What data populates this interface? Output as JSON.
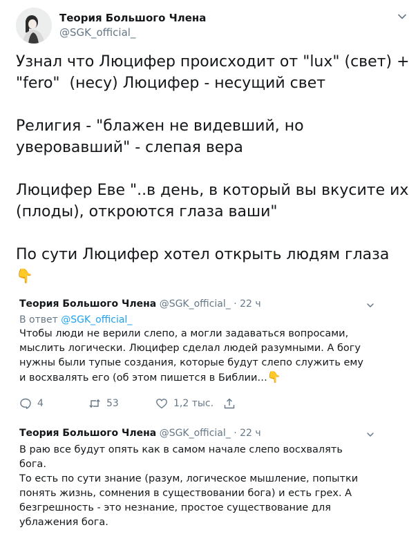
{
  "main_tweet": {
    "author_name": "Теория Большого Члена",
    "author_handle": "@SGK_official_",
    "paragraphs": [
      "Узнал что Люцифер происходит от \"lux\" (свет) + \"fero\"  (несу) Люцифер - несущий свет",
      "Религия - \"блажен не видевший, но уверовавший\" - слепая вера",
      "Люцифер Еве \"..в день, в который вы вкусите их (плоды), откроются глаза ваши\"",
      "По сути Люцифер хотел открыть людям глаза"
    ],
    "emoji": "👇"
  },
  "replies": [
    {
      "author_name": "Теория Большого Члена",
      "author_handle": "@SGK_official_",
      "separator": "·",
      "time": "22 ч",
      "reply_to_label": "В ответ",
      "reply_to_handle": "@SGK_official_",
      "text": "Чтобы люди не верили слепо, а могли задаваться вопросами, мыслить логически. Люцифер сделал людей разумными. А богу нужны были тупые создания, которые будут слепо служить ему и восхвалять его (об этом пишется в Библии…",
      "emoji": "👇",
      "replies_count": "4",
      "retweets_count": "53",
      "likes_count": "1,2 тыс."
    },
    {
      "author_name": "Теория Большого Члена",
      "author_handle": "@SGK_official_",
      "separator": "·",
      "time": "22 ч",
      "paragraphs": [
        "В раю все будут опять как в самом начале слепо восхвалять бога.",
        "То есть по сути знание (разум, логическое мышление, попытки понять жизнь, сомнения в существовании бога) и есть грех. А безгрешность - это незнание, простое существование для ублажения бога."
      ]
    }
  ],
  "colors": {
    "text": "#14171a",
    "secondary": "#657786",
    "link": "#1da1f2"
  },
  "icons": {
    "caret": "chevron-down-icon",
    "reply": "reply-icon",
    "retweet": "retweet-icon",
    "like": "heart-icon",
    "share": "share-icon"
  }
}
